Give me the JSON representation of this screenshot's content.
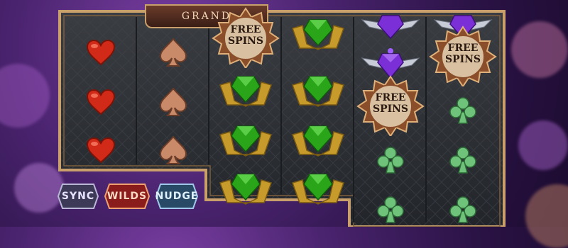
{
  "game": {
    "logo_text": "GRAND"
  },
  "colors": {
    "frame_gold": "#c9a06c",
    "reel_bg": "#2e3034",
    "heart": "#d12a18",
    "spade": "#c98a6a",
    "club": "#6ec27a",
    "emerald": "#2aa51a",
    "amethyst": "#7b2fd6"
  },
  "reels": [
    {
      "id": "reel-1",
      "symbols": [
        "heart",
        "heart",
        "heart"
      ]
    },
    {
      "id": "reel-2",
      "symbols": [
        "spade",
        "spade",
        "spade"
      ]
    },
    {
      "id": "reel-3",
      "symbols": [
        "free-spins",
        "emerald",
        "emerald",
        "emerald",
        "emerald"
      ]
    },
    {
      "id": "reel-4",
      "symbols": [
        "emerald",
        "emerald",
        "emerald",
        "emerald",
        "emerald"
      ]
    },
    {
      "id": "reel-5",
      "symbols": [
        "amethyst",
        "amethyst",
        "free-spins",
        "club",
        "club"
      ]
    },
    {
      "id": "reel-6",
      "symbols": [
        "amethyst",
        "free-spins",
        "club",
        "club",
        "club"
      ]
    }
  ],
  "free_spins_badge": {
    "line1": "FREE",
    "line2": "SPINS"
  },
  "features": [
    {
      "id": "sync",
      "label": "SYNC"
    },
    {
      "id": "wilds",
      "label": "WILDS"
    },
    {
      "id": "nudge",
      "label": "NUDGE"
    }
  ]
}
